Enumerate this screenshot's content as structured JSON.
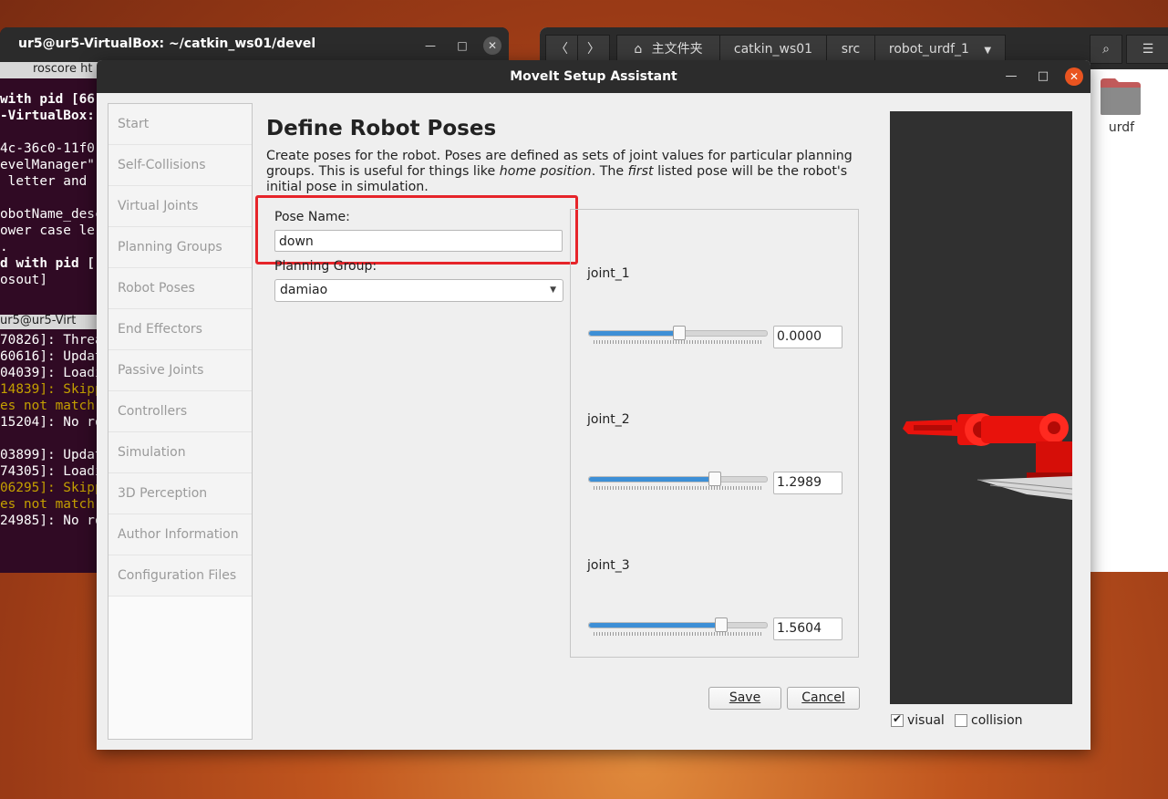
{
  "terminal": {
    "title": "ur5@ur5-VirtualBox: ~/catkin_ws01/devel",
    "tab1_label": "roscore ht",
    "tab2_label": "ur5@ur5-Virt",
    "lines_top": [
      "with pid [66",
      "-VirtualBox:",
      "",
      "4c-36c0-11f0",
      "evelManager\"",
      " letter and",
      "",
      "obotName_desc",
      "ower case le",
      ".",
      "d with pid [",
      "osout]"
    ],
    "lines_bottom": [
      "70826]: Threa",
      "60616]: Updat",
      "04039]: Loadi",
      "14839]: Skipp",
      "es not match",
      "15204]: No ro",
      "",
      "03899]: Updat",
      "74305]: Loadi",
      "06295]: Skipp",
      "es not match",
      "24985]: No ro"
    ]
  },
  "file_manager": {
    "breadcrumbs": [
      "主文件夹",
      "catkin_ws01",
      "src",
      "robot_urdf_1"
    ],
    "folder_name": "urdf"
  },
  "dialog": {
    "title": "MoveIt Setup Assistant",
    "nav_items": [
      "Start",
      "Self-Collisions",
      "Virtual Joints",
      "Planning Groups",
      "Robot Poses",
      "End Effectors",
      "Passive Joints",
      "Controllers",
      "Simulation",
      "3D Perception",
      "Author Information",
      "Configuration Files"
    ],
    "page_title": "Define Robot Poses",
    "description_parts": {
      "a": "Create poses for the robot. Poses are defined as sets of joint values for particular planning groups. This is useful for things like ",
      "b": "home position",
      "c": ". The ",
      "d": "first",
      "e": " listed pose will be the robot's initial pose in simulation."
    },
    "pose_name_label": "Pose Name:",
    "pose_name_value": "down",
    "planning_group_label": "Planning Group:",
    "planning_group_value": "damiao",
    "joints": [
      {
        "name": "joint_1",
        "value": "0.0000",
        "fraction": 0.5
      },
      {
        "name": "joint_2",
        "value": "1.2989",
        "fraction": 0.7
      },
      {
        "name": "joint_3",
        "value": "1.5604",
        "fraction": 0.74
      }
    ],
    "save_label": "Save",
    "cancel_label": "Cancel",
    "visual_label": "visual",
    "visual_checked": true,
    "collision_label": "collision",
    "collision_checked": false
  },
  "colors": {
    "accent": "#e95420",
    "highlight": "#e6242a",
    "slider_fill": "#3d8fd6",
    "robot": "#e8120c"
  }
}
